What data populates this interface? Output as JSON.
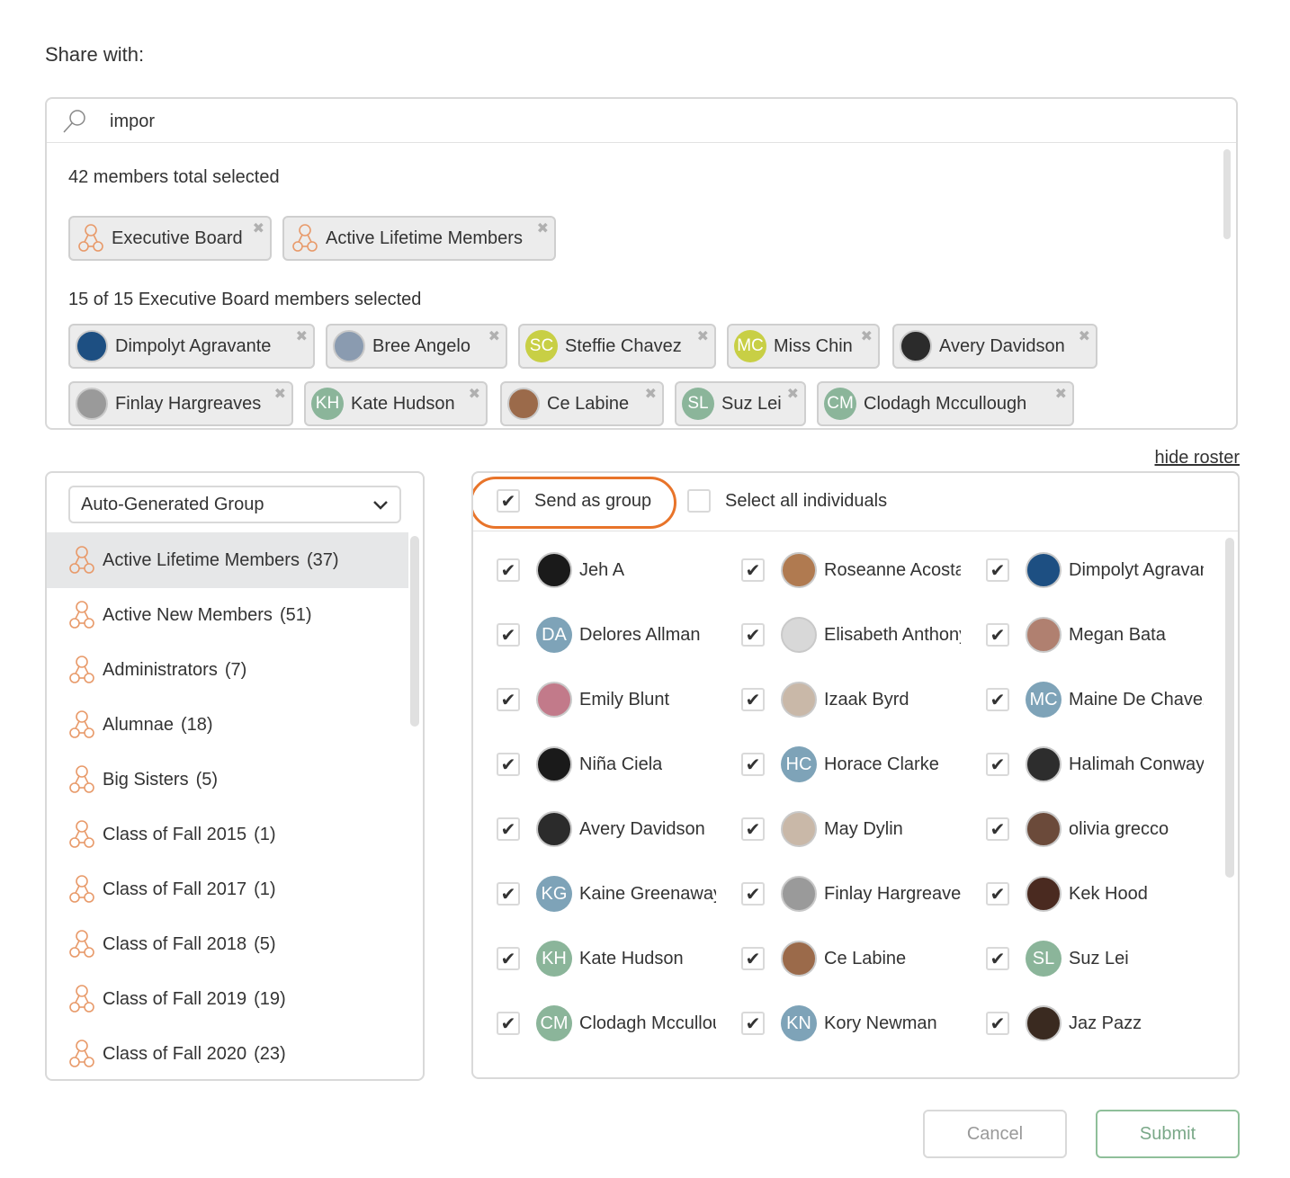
{
  "heading": "Share with:",
  "search": {
    "value": "impor"
  },
  "summary_total": "42 members total selected",
  "selected_groups": [
    {
      "label": "Executive Board"
    },
    {
      "label": "Active Lifetime Members"
    }
  ],
  "summary_group": "15 of 15 Executive Board members selected",
  "selected_members": [
    {
      "label": "Dimpolyt Agravante",
      "initials": "",
      "color": "#1d4f82"
    },
    {
      "label": "Bree Angelo",
      "initials": "",
      "color": "#8a9bb0"
    },
    {
      "label": "Steffie Chavez",
      "initials": "SC",
      "color": "#c8cf45"
    },
    {
      "label": "Miss Chin",
      "initials": "MC",
      "color": "#c8cf45"
    },
    {
      "label": "Avery Davidson",
      "initials": "",
      "color": "#2b2b2b"
    },
    {
      "label": "Finlay Hargreaves",
      "initials": "",
      "color": "#9a9a9a"
    },
    {
      "label": "Kate Hudson",
      "initials": "KH",
      "color": "#8bb59a"
    },
    {
      "label": "Ce Labine",
      "initials": "",
      "color": "#9b6a4a"
    },
    {
      "label": "Suz Lei",
      "initials": "SL",
      "color": "#8bb59a"
    },
    {
      "label": "Clodagh Mccullough",
      "initials": "CM",
      "color": "#8bb59a"
    }
  ],
  "hide_roster": "hide roster",
  "group_select": {
    "value": "Auto-Generated Group"
  },
  "groups": [
    {
      "name": "Active Lifetime Members",
      "count": "(37)"
    },
    {
      "name": "Active New Members",
      "count": "(51)"
    },
    {
      "name": "Administrators",
      "count": "(7)"
    },
    {
      "name": "Alumnae",
      "count": "(18)"
    },
    {
      "name": "Big Sisters",
      "count": "(5)"
    },
    {
      "name": "Class of Fall 2015",
      "count": "(1)"
    },
    {
      "name": "Class of Fall 2017",
      "count": "(1)"
    },
    {
      "name": "Class of Fall 2018",
      "count": "(5)"
    },
    {
      "name": "Class of Fall 2019",
      "count": "(19)"
    },
    {
      "name": "Class of Fall 2020",
      "count": "(23)"
    }
  ],
  "send_as_group": {
    "label": "Send as group",
    "checked": true,
    "check": "✔"
  },
  "select_all": {
    "label": "Select all individuals",
    "checked": false
  },
  "roster": [
    {
      "name": "Jeh A",
      "initials": "",
      "color": "#1a1a1a"
    },
    {
      "name": "Roseanne Acosta",
      "initials": "",
      "color": "#b07a50"
    },
    {
      "name": "Dimpolyt Agravante",
      "initials": "",
      "color": "#1d4f82"
    },
    {
      "name": "Delores Allman",
      "initials": "DA",
      "color": "#7ea3b8"
    },
    {
      "name": "Elisabeth Anthony",
      "initials": "",
      "color": "#d8d8d8"
    },
    {
      "name": "Megan Bata",
      "initials": "",
      "color": "#b08070"
    },
    {
      "name": "Emily Blunt",
      "initials": "",
      "color": "#c27a8a"
    },
    {
      "name": "Izaak Byrd",
      "initials": "",
      "color": "#c9b8a8"
    },
    {
      "name": "Maine De Chavez",
      "initials": "MC",
      "color": "#7ea3b8"
    },
    {
      "name": "Niña Ciela",
      "initials": "",
      "color": "#1a1a1a"
    },
    {
      "name": "Horace Clarke",
      "initials": "HC",
      "color": "#7ea3b8"
    },
    {
      "name": "Halimah Conway",
      "initials": "",
      "color": "#2d2d2d"
    },
    {
      "name": "Avery Davidson",
      "initials": "",
      "color": "#2b2b2b"
    },
    {
      "name": "May Dylin",
      "initials": "",
      "color": "#c9b8a8"
    },
    {
      "name": "olivia grecco",
      "initials": "",
      "color": "#6b4a3a"
    },
    {
      "name": "Kaine Greenaway",
      "initials": "KG",
      "color": "#7ea3b8"
    },
    {
      "name": "Finlay Hargreaves",
      "initials": "",
      "color": "#9a9a9a"
    },
    {
      "name": "Kek Hood",
      "initials": "",
      "color": "#4a2a20"
    },
    {
      "name": "Kate Hudson",
      "initials": "KH",
      "color": "#8bb59a"
    },
    {
      "name": "Ce Labine",
      "initials": "",
      "color": "#9b6a4a"
    },
    {
      "name": "Suz Lei",
      "initials": "SL",
      "color": "#8bb59a"
    },
    {
      "name": "Clodagh Mccullough",
      "initials": "CM",
      "color": "#8bb59a"
    },
    {
      "name": "Kory Newman",
      "initials": "KN",
      "color": "#7ea3b8"
    },
    {
      "name": "Jaz Pazz",
      "initials": "",
      "color": "#3a2a20"
    }
  ],
  "roster_check": "✔",
  "chip_close": "✖",
  "buttons": {
    "cancel": "Cancel",
    "submit": "Submit"
  },
  "colors": {
    "accent_orange": "#e8742a",
    "submit_green": "#7aa888",
    "group_icon": "#e89a6a"
  }
}
